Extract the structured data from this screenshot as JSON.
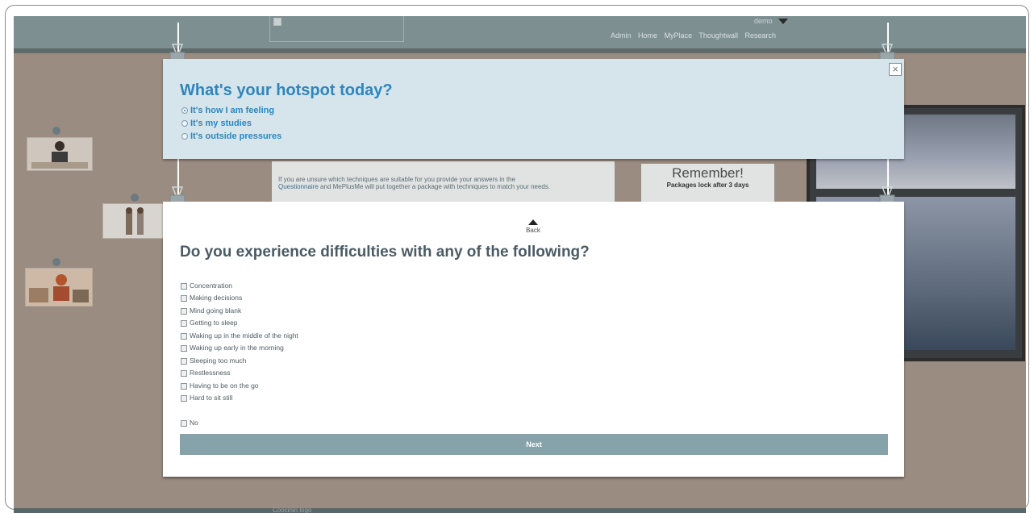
{
  "header": {
    "user": "demo",
    "nav": [
      "Admin",
      "Home",
      "MyPlace",
      "Thoughtwall",
      "Research"
    ]
  },
  "background": {
    "note_text_before": "If you are unsure which techniques are suitable for you provide your answers in the",
    "note_link": "Questionnaire",
    "note_text_after": "and MePlusMe will put together a package with techniques to match your needs.",
    "remember_title": "Remember!",
    "remember_sub": "Packages lock after 3 days"
  },
  "hotspot": {
    "title": "What's your hotspot today?",
    "options": [
      "It's how I am feeling",
      "It's my studies",
      "It's outside pressures"
    ],
    "selected_index": 0
  },
  "questionnaire": {
    "back_label": "Back",
    "title": "Do you experience difficulties with any of the following?",
    "items": [
      "Concentration",
      "Making decisions",
      "Mind going blank",
      "Getting to sleep",
      "Waking up in the middle of the night",
      "Waking up early in the morning",
      "Sleeping too much",
      "Restlessness",
      "Having to be on the go",
      "Hard to sit still"
    ],
    "none_label": "No",
    "next_label": "Next"
  },
  "footer": {
    "logo_alt": "Coocinin logo"
  }
}
